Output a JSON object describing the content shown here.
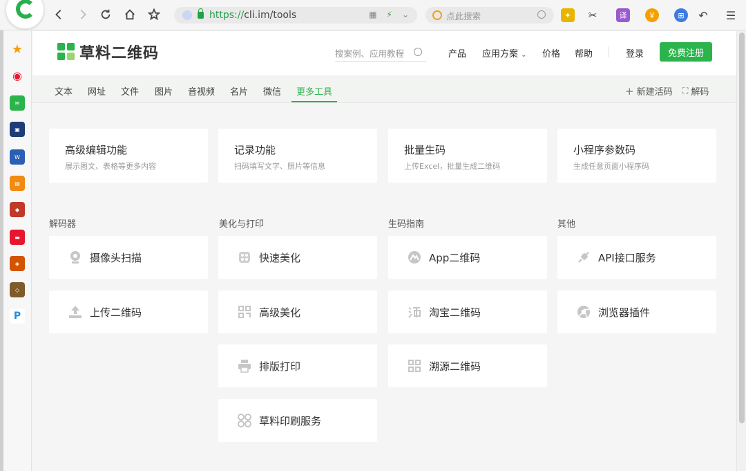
{
  "browser": {
    "url_scheme": "https://",
    "url_host": "cli.im/tools",
    "search_placeholder": "点此搜索",
    "ext_translate": "译"
  },
  "header": {
    "logo_text": "草料二维码",
    "search_placeholder": "搜案例、应用教程",
    "nav": {
      "product": "产品",
      "solutions": "应用方案",
      "pricing": "价格",
      "help": "帮助",
      "login": "登录",
      "register": "免费注册"
    }
  },
  "tabs": {
    "items": [
      "文本",
      "网址",
      "文件",
      "图片",
      "音视频",
      "名片",
      "微信",
      "更多工具"
    ],
    "active": "更多工具",
    "new_live_code": "新建活码",
    "decode": "解码"
  },
  "top_cards": [
    {
      "title": "高级编辑功能",
      "desc": "展示图文、表格等更多内容"
    },
    {
      "title": "记录功能",
      "desc": "扫码填写文字、照片等信息"
    },
    {
      "title": "批量生码",
      "desc": "上传Excel，批量生成二维码"
    },
    {
      "title": "小程序参数码",
      "desc": "生成任意页面小程序码"
    }
  ],
  "sections": [
    {
      "title": "解码器",
      "tools": [
        {
          "label": "摄像头扫描",
          "icon": "camera-icon"
        },
        {
          "label": "上传二维码",
          "icon": "upload-icon"
        }
      ]
    },
    {
      "title": "美化与打印",
      "tools": [
        {
          "label": "快速美化",
          "icon": "beautify-icon"
        },
        {
          "label": "高级美化",
          "icon": "qr-style-icon"
        },
        {
          "label": "排版打印",
          "icon": "printer-icon"
        },
        {
          "label": "草料印刷服务",
          "icon": "print-service-icon"
        }
      ]
    },
    {
      "title": "生码指南",
      "tools": [
        {
          "label": "App二维码",
          "icon": "app-icon"
        },
        {
          "label": "淘宝二维码",
          "icon": "taobao-icon"
        },
        {
          "label": "溯源二维码",
          "icon": "trace-qr-icon"
        }
      ]
    },
    {
      "title": "其他",
      "tools": [
        {
          "label": "API接口服务",
          "icon": "api-icon"
        },
        {
          "label": "浏览器插件",
          "icon": "browser-plugin-icon"
        }
      ]
    }
  ],
  "colors": {
    "brand_green": "#2bb44c",
    "icon_gray": "#b5b5b5"
  }
}
